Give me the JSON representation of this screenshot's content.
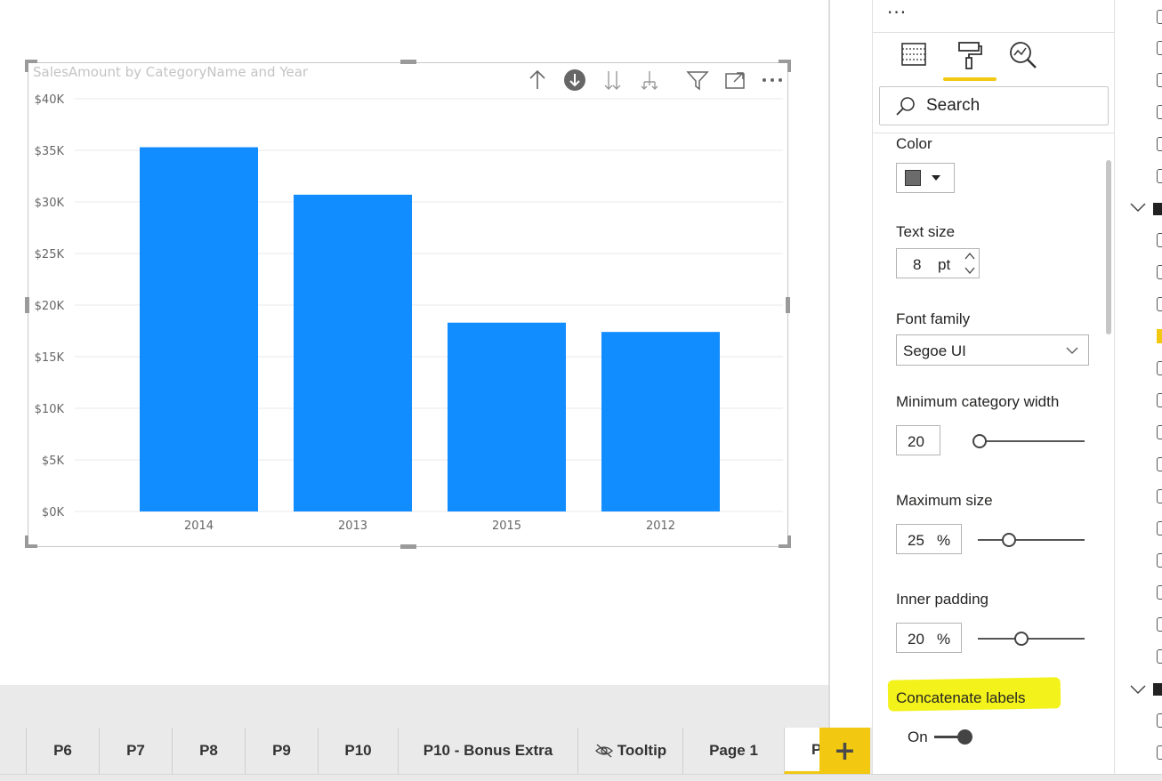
{
  "visual": {
    "title": "SalesAmount by CategoryName and Year"
  },
  "chart_data": {
    "type": "bar",
    "categories": [
      "2014",
      "2013",
      "2015",
      "2012"
    ],
    "values": [
      35300,
      30700,
      18300,
      17400
    ],
    "title": "SalesAmount by CategoryName and Year",
    "xlabel": "",
    "ylabel": "",
    "ylim": [
      0,
      40000
    ],
    "yticks": [
      "$0K",
      "$5K",
      "$10K",
      "$15K",
      "$20K",
      "$25K",
      "$30K",
      "$35K",
      "$40K"
    ],
    "grid": true,
    "bar_color": "#118dff"
  },
  "panel": {
    "search_label": "Search",
    "color_label": "Color",
    "color_swatch": "#6b6b6b",
    "text_size_label": "Text size",
    "text_size_value": "8",
    "text_size_unit": "pt",
    "font_family_label": "Font family",
    "font_family_value": "Segoe UI",
    "min_cat_label": "Minimum category width",
    "min_cat_value": "20",
    "max_size_label": "Maximum size",
    "max_size_value": "25",
    "max_size_unit": "%",
    "inner_padding_label": "Inner padding",
    "inner_padding_value": "20",
    "inner_padding_unit": "%",
    "concat_label": "Concatenate labels",
    "concat_toggle": "On",
    "accent": "#f2c811",
    "highlight": "#f3f21a"
  },
  "tabs": [
    {
      "label": "P6"
    },
    {
      "label": "P7"
    },
    {
      "label": "P8"
    },
    {
      "label": "P9"
    },
    {
      "label": "P10"
    },
    {
      "label": "P10 - Bonus Extra"
    },
    {
      "label": "Tooltip"
    },
    {
      "label": "Page 1"
    },
    {
      "label": "P"
    }
  ],
  "add_page_symbol": "+"
}
